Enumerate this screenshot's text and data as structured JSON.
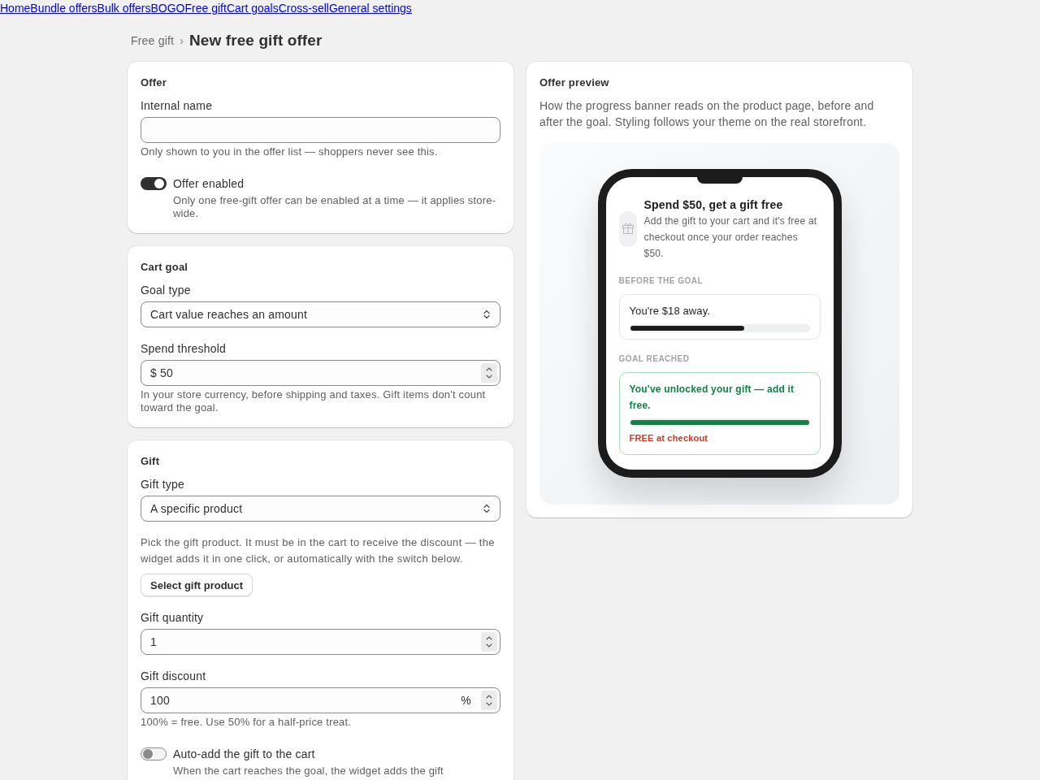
{
  "nav_links": [
    "Home",
    "Bundle offers",
    "Bulk offers",
    "BOGO",
    "Free gift",
    "Cart goals",
    "Cross-sell",
    "General settings"
  ],
  "breadcrumb": {
    "parent": "Free gift",
    "separator": "›",
    "title": "New free gift offer"
  },
  "sections": [
    {
      "title": "Offer",
      "fields": [
        {
          "kind": "text",
          "label": "Internal name",
          "help": "Only shown to you in the offer list — shoppers never see this."
        },
        {
          "kind": "toggle",
          "label": "Offer enabled",
          "on": true,
          "help": "Only one free-gift offer can be enabled at a time — it applies store-wide."
        }
      ]
    },
    {
      "title": "Cart goal",
      "fields": [
        {
          "kind": "select",
          "label": "Goal type",
          "value": "Cart value reaches an amount"
        },
        {
          "kind": "number",
          "label": "Spend threshold",
          "prefix": "$",
          "value": "50",
          "help": "In your store currency, before shipping and taxes. Gift items don't count toward the goal."
        }
      ]
    },
    {
      "title": "Gift",
      "fields": [
        {
          "kind": "select",
          "label": "Gift type",
          "value": "A specific product"
        },
        {
          "kind": "picker",
          "note": "Pick the gift product. It must be in the cart to receive the discount — the widget adds it in one click, or automatically with the switch below.",
          "button": "Select gift product"
        },
        {
          "kind": "number",
          "label": "Gift quantity",
          "value": "1"
        },
        {
          "kind": "number",
          "label": "Gift discount",
          "value": "100",
          "suffix": "%",
          "help": "100% = free. Use 50% for a half-price treat."
        },
        {
          "kind": "toggle",
          "label": "Auto-add the gift to the cart",
          "on": false,
          "help": "When the cart reaches the goal, the widget adds the gift"
        }
      ]
    }
  ],
  "preview": {
    "title": "Offer preview",
    "description": "How the progress banner reads on the product page, before and after the goal. Styling follows your theme on the real storefront.",
    "headline": "Spend $50, get a gift free",
    "body": "Add the gift to your cart and it's free at checkout once your order reaches $50.",
    "states": [
      {
        "kind": "before",
        "label": "BEFORE THE GOAL",
        "message": "You're $18 away.",
        "level": 0.64
      },
      {
        "kind": "reached",
        "label": "GOAL REACHED",
        "message": "You've unlocked your gift — add it free.",
        "level": 1,
        "note": "FREE at checkout"
      }
    ]
  }
}
